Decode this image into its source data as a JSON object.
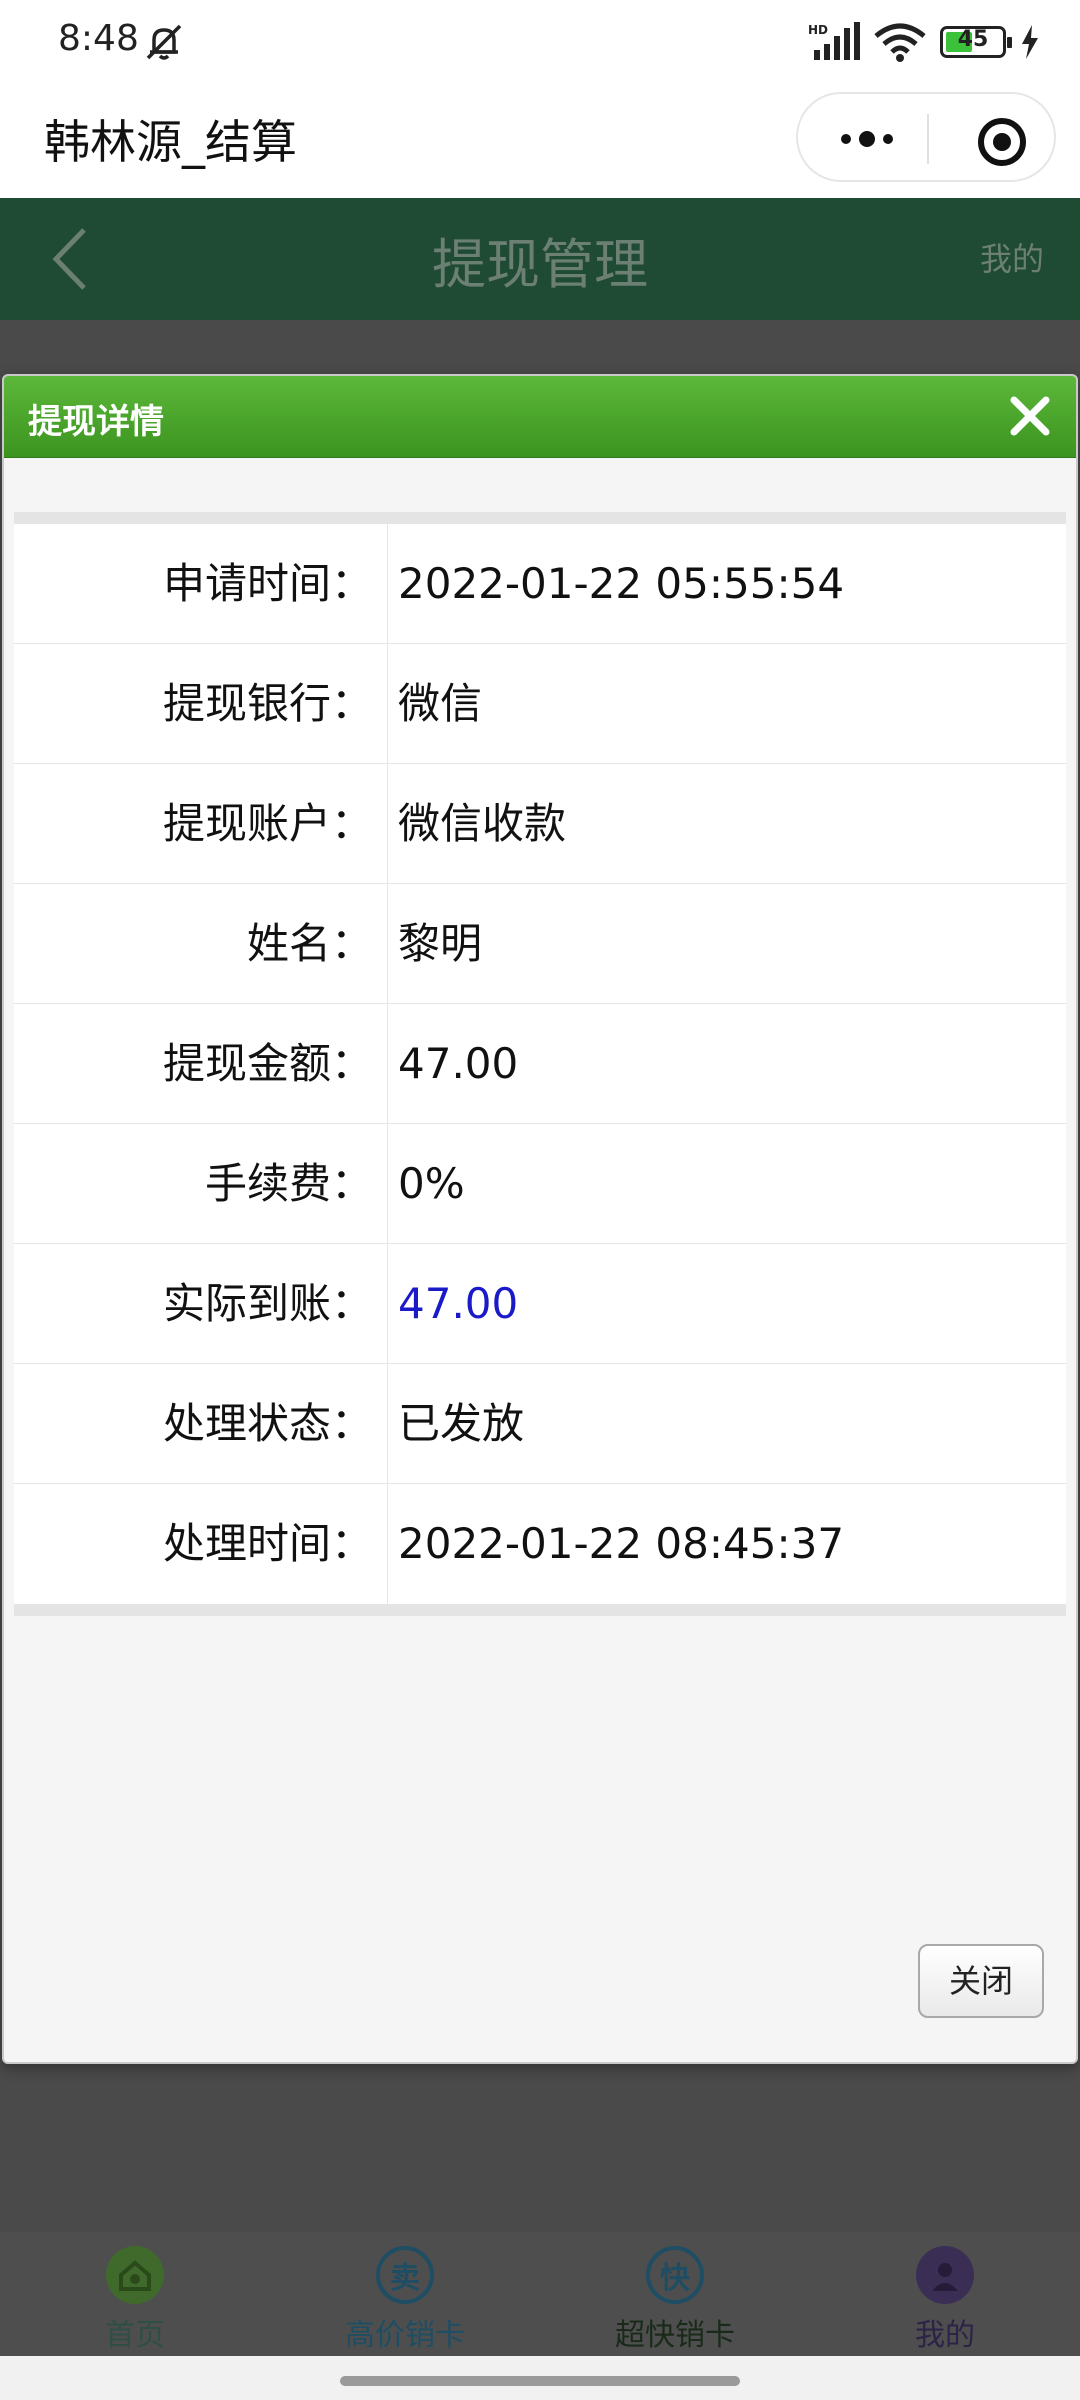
{
  "status_bar": {
    "time": "8:48",
    "icons": [
      "bell-off-icon",
      "hd-signal-icon",
      "wifi-icon",
      "battery-icon",
      "charging-bolt-icon"
    ],
    "hd_label": "HD",
    "battery_level": "45"
  },
  "mini_program": {
    "title": "韩林源_结算",
    "capsule_icons": [
      "more-dots-icon",
      "target-icon"
    ]
  },
  "page_header": {
    "title": "提现管理",
    "right_label": "我的"
  },
  "dialog": {
    "title": "提现详情",
    "close_button_label": "关闭",
    "rows": [
      {
        "label": "申请时间：",
        "value": "2022-01-22 05:55:54"
      },
      {
        "label": "提现银行：",
        "value": "微信"
      },
      {
        "label": "提现账户：",
        "value": "微信收款"
      },
      {
        "label": "姓名：",
        "value": "黎明"
      },
      {
        "label": "提现金额：",
        "value": "47.00"
      },
      {
        "label": "手续费：",
        "value": "0%"
      },
      {
        "label": "实际到账：",
        "value": "47.00"
      },
      {
        "label": "处理状态：",
        "value": "已发放"
      },
      {
        "label": "处理时间：",
        "value": "2022-01-22 08:45:37"
      }
    ]
  },
  "tabbar": {
    "items": [
      {
        "label": "首页",
        "icon_char": "",
        "icon": "home-icon",
        "active": true
      },
      {
        "label": "高价销卡",
        "icon_char": "卖",
        "icon": "sell-icon",
        "active": false
      },
      {
        "label": "超快销卡",
        "icon_char": "快",
        "icon": "fast-icon",
        "active": false
      },
      {
        "label": "我的",
        "icon_char": "",
        "icon": "user-icon",
        "active": false
      }
    ]
  },
  "colors": {
    "dialog_header": "#4aa52b",
    "page_header": "#1f4a33",
    "highlight_value": "#1a1ac8",
    "tab_active": "#5c8a2f",
    "tab_inactive": "#1f4d63"
  }
}
